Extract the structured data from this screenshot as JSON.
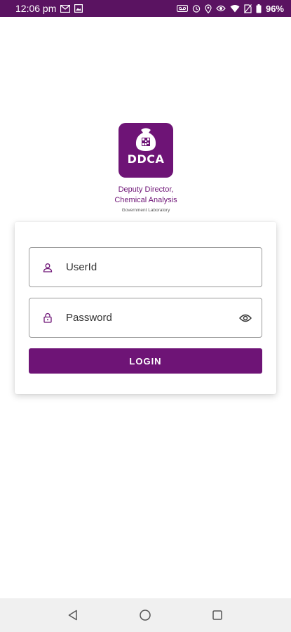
{
  "status_bar": {
    "time": "12:06 pm",
    "battery": "96%",
    "left_icons": [
      "gmail-icon",
      "gallery-icon"
    ],
    "right_icons": [
      "voicemail-icon",
      "alarm-icon",
      "location-icon",
      "eye-comfort-icon",
      "wifi-icon",
      "no-sim-icon",
      "battery-icon"
    ]
  },
  "app": {
    "logo_text": "DDCA",
    "title_line1": "Deputy Director,",
    "title_line2": "Chemical Analysis",
    "subtitle": "Government Laboratory"
  },
  "login_form": {
    "userid_placeholder": "UserId",
    "password_placeholder": "Password",
    "login_label": "LOGIN"
  },
  "colors": {
    "brand": "#6e1476",
    "status_bar": "#5a1361",
    "nav_bar": "#f0f0f0"
  },
  "nav_bar": {
    "buttons": [
      "back-icon",
      "home-icon",
      "recents-icon"
    ]
  }
}
